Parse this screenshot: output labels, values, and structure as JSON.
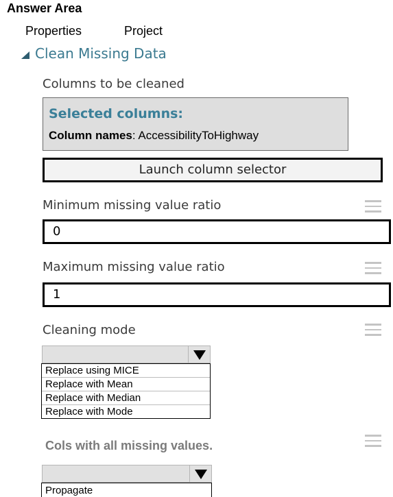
{
  "header": {
    "title": "Answer Area"
  },
  "tabs": [
    {
      "label": "Properties"
    },
    {
      "label": "Project"
    }
  ],
  "section": {
    "title": "Clean Missing Data"
  },
  "columns_to_clean": {
    "label": "Columns to be cleaned",
    "selected_title": "Selected columns:",
    "names_label": "Column names",
    "names_value": ": AccessibilityToHighway",
    "launch_button": "Launch column selector"
  },
  "min_ratio": {
    "label": "Minimum missing value ratio",
    "value": "0"
  },
  "max_ratio": {
    "label": "Maximum missing value ratio",
    "value": "1"
  },
  "cleaning_mode": {
    "label": "Cleaning mode",
    "selected": "",
    "options": [
      "Replace using MICE",
      "Replace with Mean",
      "Replace with Median",
      "Replace with Mode"
    ]
  },
  "cols_all_missing": {
    "label": "Cols with all missing values.",
    "selected": "",
    "options": [
      "Propagate"
    ]
  },
  "icons": {
    "menu": "hamburger-menu-icon",
    "collapse": "triangle-collapse-icon",
    "dropdown": "caret-down-icon"
  }
}
